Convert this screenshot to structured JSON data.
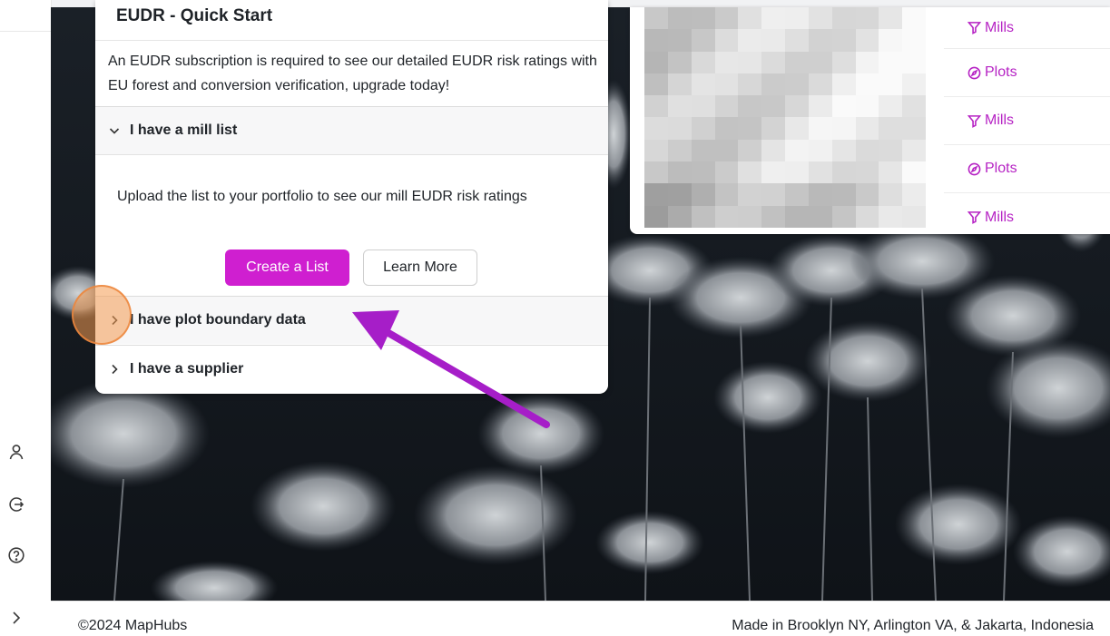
{
  "card": {
    "title": "EUDR - Quick Start",
    "description": "An EUDR subscription is required to see our detailed EUDR risk ratings with EU forest and conversion verification, upgrade today!",
    "sections": [
      {
        "label": "I have a mill list",
        "expanded": true,
        "body": "Upload the list to your portfolio to see our mill EUDR risk ratings",
        "primary_button": "Create a List",
        "secondary_button": "Learn More"
      },
      {
        "label": "I have plot boundary data",
        "expanded": false
      },
      {
        "label": "I have a supplier",
        "expanded": false
      }
    ]
  },
  "preview": {
    "tags": [
      {
        "label": "Mills",
        "icon": "funnel-icon"
      },
      {
        "label": "Plots",
        "icon": "compass-icon"
      },
      {
        "label": "Mills",
        "icon": "funnel-icon"
      },
      {
        "label": "Plots",
        "icon": "compass-icon"
      },
      {
        "label": "Mills",
        "icon": "funnel-icon"
      }
    ]
  },
  "rail": {
    "icons": [
      "user-icon",
      "logout-icon",
      "help-icon",
      "chevron-right-icon"
    ]
  },
  "footer": {
    "copyright": "©2024 MapHubs",
    "made_in": "Made in Brooklyn NY, Arlington VA, & Jakarta, Indonesia"
  },
  "colors": {
    "accent": "#cf1fd0",
    "tag_text": "#b623c4",
    "click_indicator": "#f49a50",
    "annotation_arrow": "#a61ec8"
  }
}
